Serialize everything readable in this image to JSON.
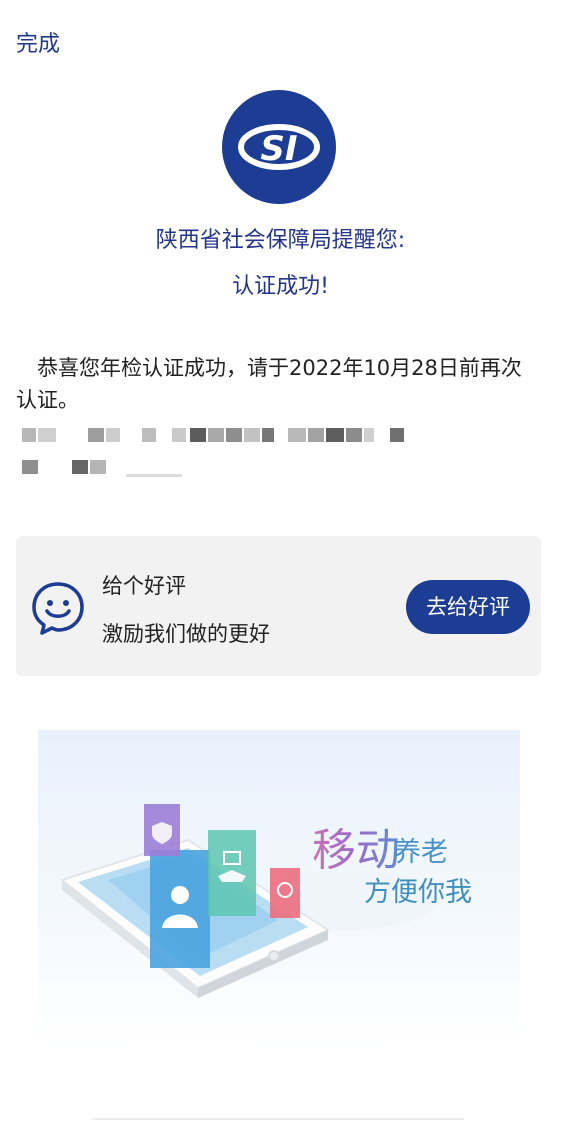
{
  "topbar": {
    "done_label": "完成"
  },
  "logo": {
    "icon": "si-logo-icon",
    "color": "#1c3d93"
  },
  "header": {
    "line1": "陕西省社会保障局提醒您:",
    "line2": "认证成功!"
  },
  "message": {
    "text": "恭喜您年检认证成功，请于2022年10月28日前再次认证。"
  },
  "review": {
    "icon": "smile-chat-icon",
    "title": "给个好评",
    "subtitle": "激励我们做的更好",
    "button_label": "去给好评"
  },
  "banner": {
    "title_main": "移动",
    "title_tail": "养老",
    "subtitle": "方便你我"
  },
  "colors": {
    "primary": "#1c3d93",
    "heading": "#23368a",
    "card_bg": "#f2f2f2"
  }
}
